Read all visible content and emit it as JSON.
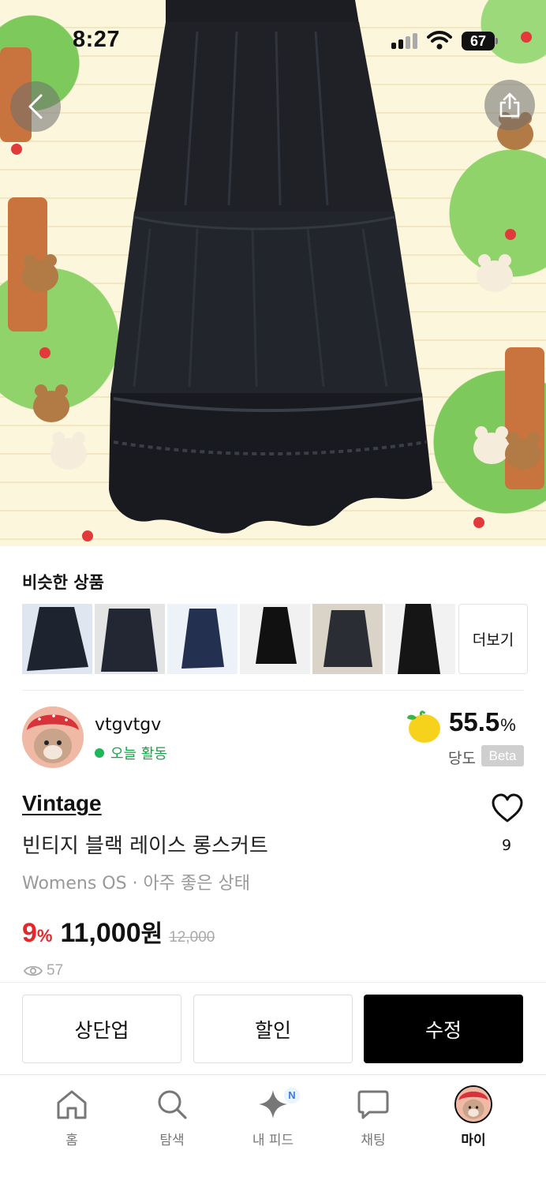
{
  "status_bar": {
    "time": "8:27",
    "battery": "67"
  },
  "hero": {
    "image_alt": "black tiered lace long skirt on illustrated background"
  },
  "nav": {
    "back_icon": "chevron-left-icon",
    "share_icon": "share-icon"
  },
  "similar": {
    "title": "비슷한 상품",
    "more_label": "더보기"
  },
  "seller": {
    "name": "vtgvtgv",
    "activity": "오늘 활동",
    "score": "55.5",
    "score_unit": "%",
    "score_label": "당도",
    "beta": "Beta"
  },
  "product": {
    "brand": "Vintage",
    "title": "빈티지 블랙 레이스 롱스커트",
    "meta": "Womens OS · 아주 좋은 상태",
    "discount": "9",
    "discount_unit": "%",
    "price": "11,000",
    "currency": "원",
    "original_price": "12,000",
    "views": "57",
    "likes": "9"
  },
  "actions": {
    "bump": "상단업",
    "discount": "할인",
    "edit": "수정"
  },
  "tabs": [
    {
      "label": "홈",
      "icon": "home-icon"
    },
    {
      "label": "탐색",
      "icon": "search-icon"
    },
    {
      "label": "내 피드",
      "icon": "sparkle-icon",
      "badge": "N"
    },
    {
      "label": "채팅",
      "icon": "chat-icon"
    },
    {
      "label": "마이",
      "icon": "profile-avatar",
      "active": true
    }
  ],
  "colors": {
    "discount": "#e5262a",
    "activity": "#1fb65a",
    "primary_button": "#000000"
  }
}
